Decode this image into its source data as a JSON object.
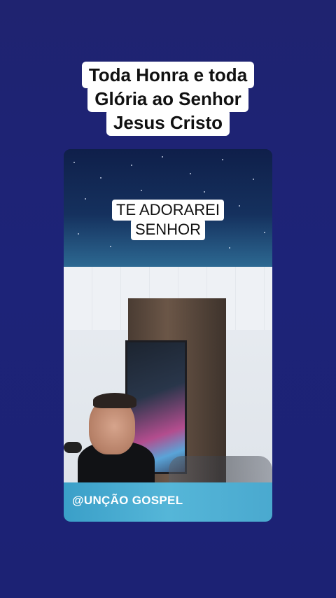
{
  "title": {
    "lines": [
      "Toda Honra e toda",
      "Glória ao Senhor",
      "Jesus Cristo"
    ]
  },
  "video": {
    "overlay_lines": [
      "TE ADORAREI",
      "SENHOR"
    ],
    "watermark": "@UNÇÃO GOSPEL"
  }
}
